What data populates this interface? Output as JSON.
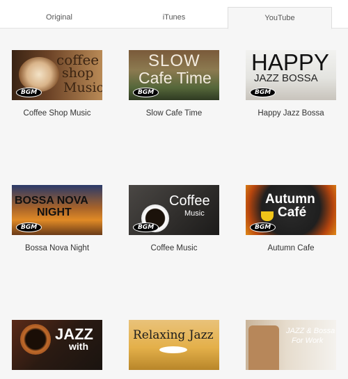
{
  "tabs": [
    {
      "label": "Original",
      "active": false
    },
    {
      "label": "iTunes",
      "active": false
    },
    {
      "label": "YouTube",
      "active": true
    }
  ],
  "videos": [
    {
      "caption": "Coffee Shop Music",
      "thumb_text": [
        "coffee",
        "shop",
        "Music"
      ],
      "badge": "BGM"
    },
    {
      "caption": "Slow Cafe Time",
      "thumb_text": [
        "SLOW",
        "Cafe Time"
      ],
      "badge": "BGM"
    },
    {
      "caption": "Happy Jazz Bossa",
      "thumb_text": [
        "HAPPY",
        "JAZZ BOSSA"
      ],
      "badge": "BGM"
    },
    {
      "caption": "Bossa Nova Night",
      "thumb_text": [
        "BOSSA NOVA",
        "NIGHT"
      ],
      "badge": "BGM"
    },
    {
      "caption": "Coffee Music",
      "thumb_text": [
        "Coffee",
        "Music"
      ],
      "badge": "BGM"
    },
    {
      "caption": "Autumn Cafe",
      "thumb_text": [
        "Autumn",
        "Café"
      ],
      "badge": "BGM"
    },
    {
      "caption": "",
      "thumb_text": [
        "JAZZ",
        "with"
      ],
      "badge": ""
    },
    {
      "caption": "",
      "thumb_text": [
        "Relaxing Jazz"
      ],
      "badge": ""
    },
    {
      "caption": "",
      "thumb_text": [
        "JAZZ & Bossa",
        "For Work"
      ],
      "badge": ""
    }
  ]
}
